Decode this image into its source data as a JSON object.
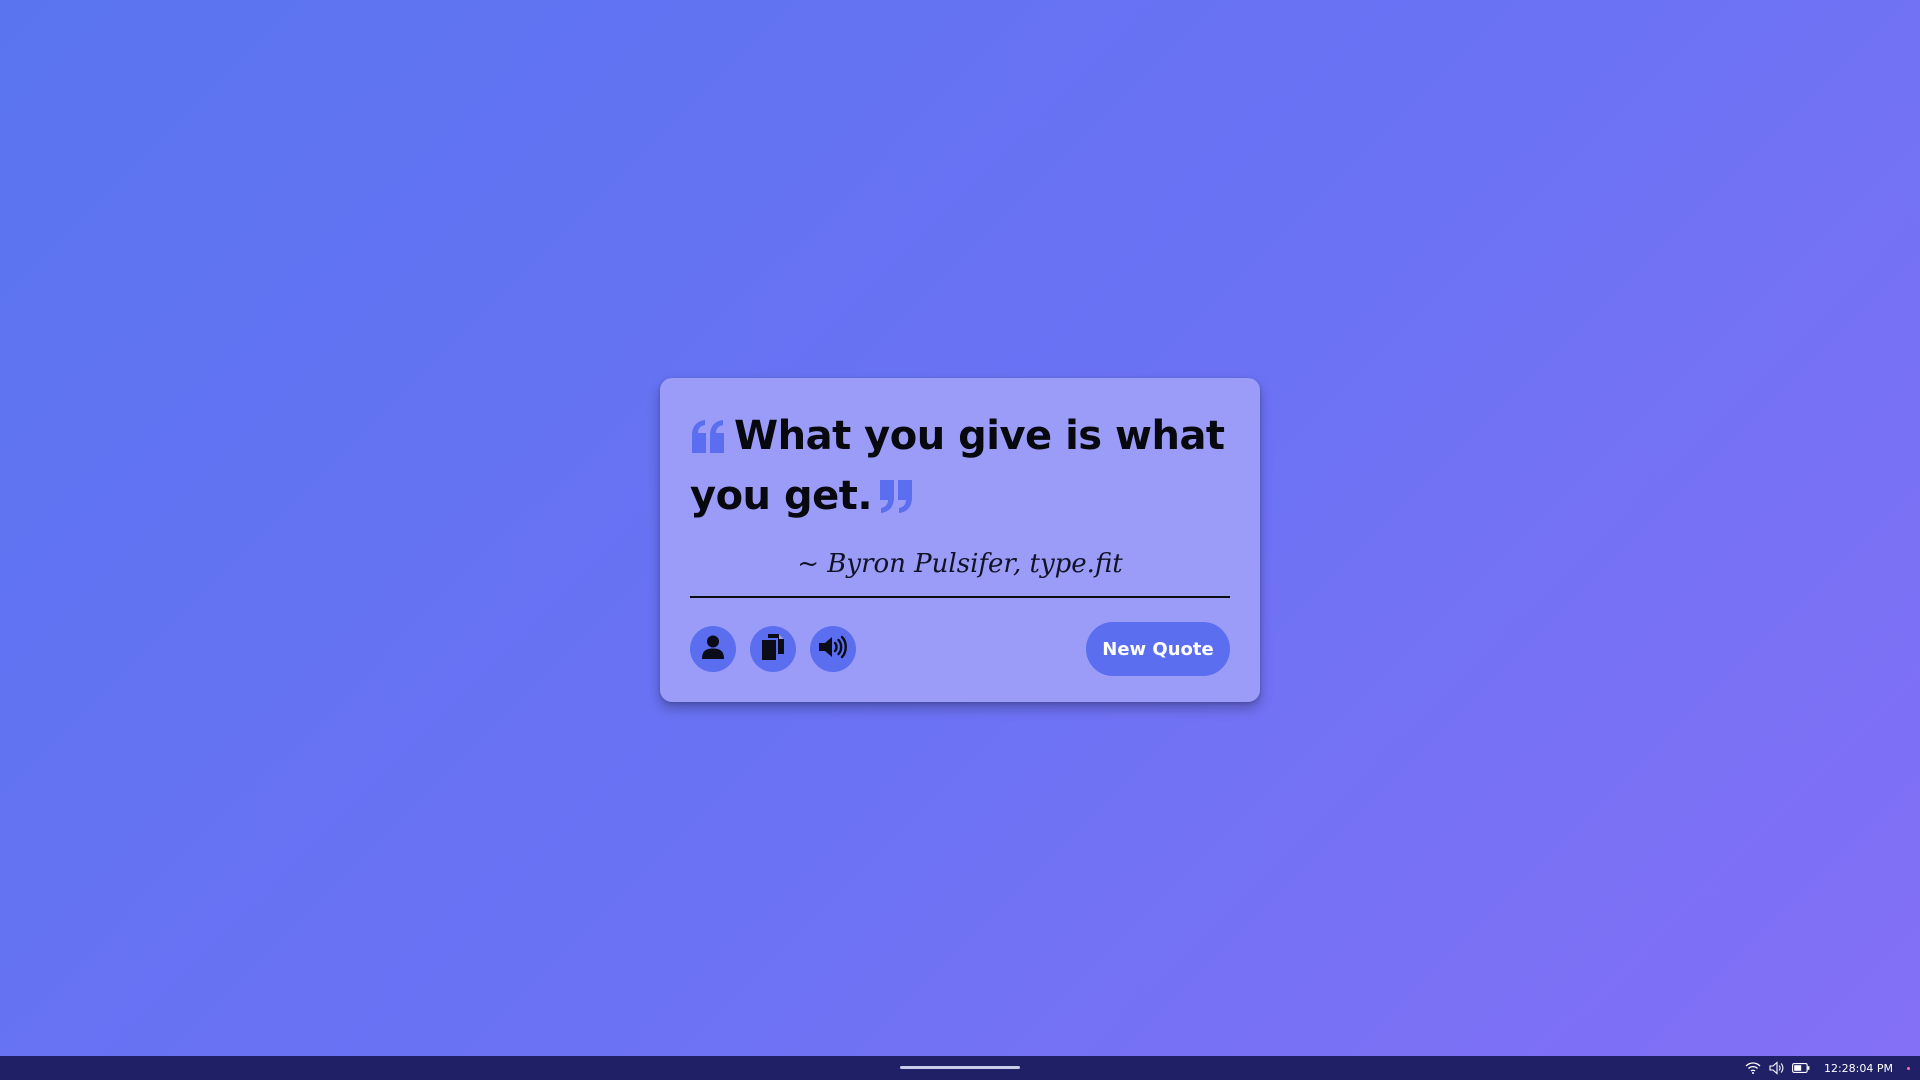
{
  "quote": {
    "text": "What you give is what you get.",
    "author": "~ Byron Pulsifer, type.fit",
    "open_mark_icon": "quote-left-icon",
    "close_mark_icon": "quote-right-icon"
  },
  "actions": {
    "buttons": [
      {
        "name": "author-button",
        "icon": "user-icon"
      },
      {
        "name": "copy-button",
        "icon": "copy-icon"
      },
      {
        "name": "speak-button",
        "icon": "speaker-icon"
      }
    ],
    "new_quote_label": "New Quote"
  },
  "taskbar": {
    "tray_icons": [
      "wifi-icon",
      "volume-icon",
      "battery-icon"
    ],
    "clock": "12:28:04 PM"
  },
  "colors": {
    "background_start": "#5a74f0",
    "background_end": "#8470f6",
    "card": "#9a9cf7",
    "accent": "#5b6ef0",
    "taskbar": "#1f2066"
  }
}
